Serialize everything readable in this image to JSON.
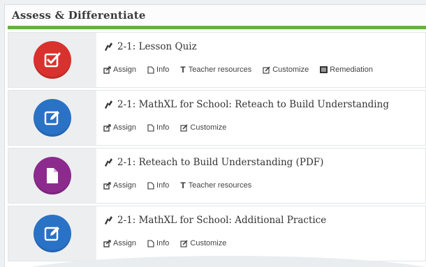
{
  "section": {
    "title": "Assess & Differentiate"
  },
  "colors": {
    "accent": "#6cae3f",
    "red": "#d9322e",
    "blue": "#2a72c6",
    "purple": "#8c2b8d"
  },
  "items": [
    {
      "title": "2-1: Lesson Quiz",
      "icon": "checkbox-icon",
      "actions": {
        "assign": "Assign",
        "info": "Info",
        "teacher_resources": "Teacher resources",
        "customize": "Customize",
        "remediation": "Remediation"
      }
    },
    {
      "title": "2-1: MathXL for School: Reteach to Build Understanding",
      "icon": "pencil-edit-icon",
      "actions": {
        "assign": "Assign",
        "info": "Info",
        "customize": "Customize"
      }
    },
    {
      "title": "2-1: Reteach to Build Understanding (PDF)",
      "icon": "document-icon",
      "actions": {
        "assign": "Assign",
        "info": "Info",
        "teacher_resources": "Teacher resources"
      }
    },
    {
      "title": "2-1: MathXL for School: Additional Practice",
      "icon": "pencil-edit-icon",
      "actions": {
        "assign": "Assign",
        "info": "Info",
        "customize": "Customize"
      }
    }
  ]
}
